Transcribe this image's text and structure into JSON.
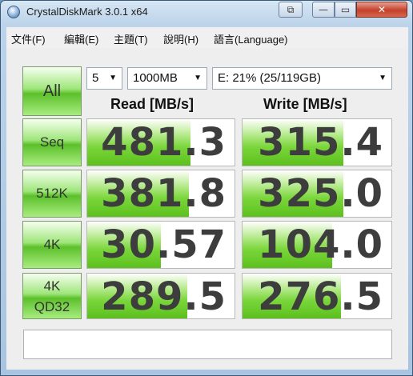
{
  "window": {
    "title": "CrystalDiskMark 3.0.1 x64"
  },
  "menu": [
    {
      "label": "文件(F)"
    },
    {
      "label": "編輯(E)"
    },
    {
      "label": "主題(T)"
    },
    {
      "label": "說明(H)"
    },
    {
      "label": "語言(Language)"
    }
  ],
  "controls": {
    "all_label": "All",
    "count": "5",
    "size": "1000MB",
    "drive": "E: 21% (25/119GB)"
  },
  "headers": {
    "read": "Read [MB/s]",
    "write": "Write [MB/s]"
  },
  "tests": [
    {
      "label": "Seq",
      "read": "481.3",
      "write": "315.4",
      "read_fill": 0.7,
      "write_fill": 0.68
    },
    {
      "label": "512K",
      "read": "381.8",
      "write": "325.0",
      "read_fill": 0.69,
      "write_fill": 0.68
    },
    {
      "label": "4K",
      "read": "30.57",
      "write": "104.0",
      "read_fill": 0.5,
      "write_fill": 0.6
    },
    {
      "label": "4K\nQD32",
      "read": "289.5",
      "write": "276.5",
      "read_fill": 0.68,
      "write_fill": 0.66
    }
  ],
  "status": ""
}
